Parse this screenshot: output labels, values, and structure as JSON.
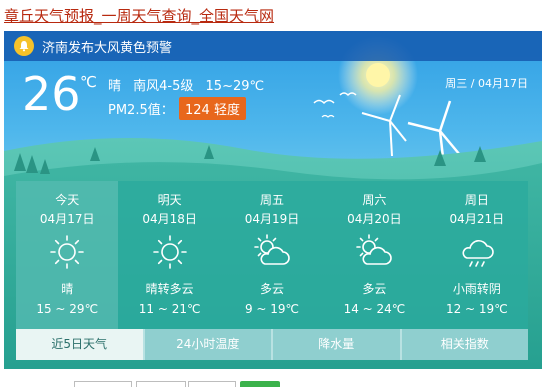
{
  "header": {
    "title": "章丘天气预报_一周天气查询_全国天气网"
  },
  "alert": {
    "text": "济南发布大风黄色预警",
    "icon": "bell-icon"
  },
  "current": {
    "temperature": "26",
    "unit": "℃",
    "condition": "晴",
    "wind": "南风4-5级",
    "range": "15~29℃",
    "pm_label": "PM2.5值：",
    "pm_value": "124 轻度",
    "date": "周三 / 04月17日"
  },
  "colors": {
    "pm_badge": "#e8671c",
    "alert_bar": "#165cb0",
    "forecast_bg": "#2aaa9e",
    "tab_bg": "#8fcfcf"
  },
  "forecast": [
    {
      "name": "今天",
      "date": "04月17日",
      "icon": "sun-icon",
      "desc": "晴",
      "range": "15 ~ 29℃"
    },
    {
      "name": "明天",
      "date": "04月18日",
      "icon": "sun-icon",
      "desc": "晴转多云",
      "range": "11 ~ 21℃"
    },
    {
      "name": "周五",
      "date": "04月19日",
      "icon": "partly-cloudy-icon",
      "desc": "多云",
      "range": "9 ~ 19℃"
    },
    {
      "name": "周六",
      "date": "04月20日",
      "icon": "partly-cloudy-icon",
      "desc": "多云",
      "range": "14 ~ 24℃"
    },
    {
      "name": "周日",
      "date": "04月21日",
      "icon": "rain-icon",
      "desc": "小雨转阴",
      "range": "12 ~ 19℃"
    }
  ],
  "tabs": [
    "近5日天气",
    "24小时温度",
    "降水量",
    "相关指数"
  ]
}
